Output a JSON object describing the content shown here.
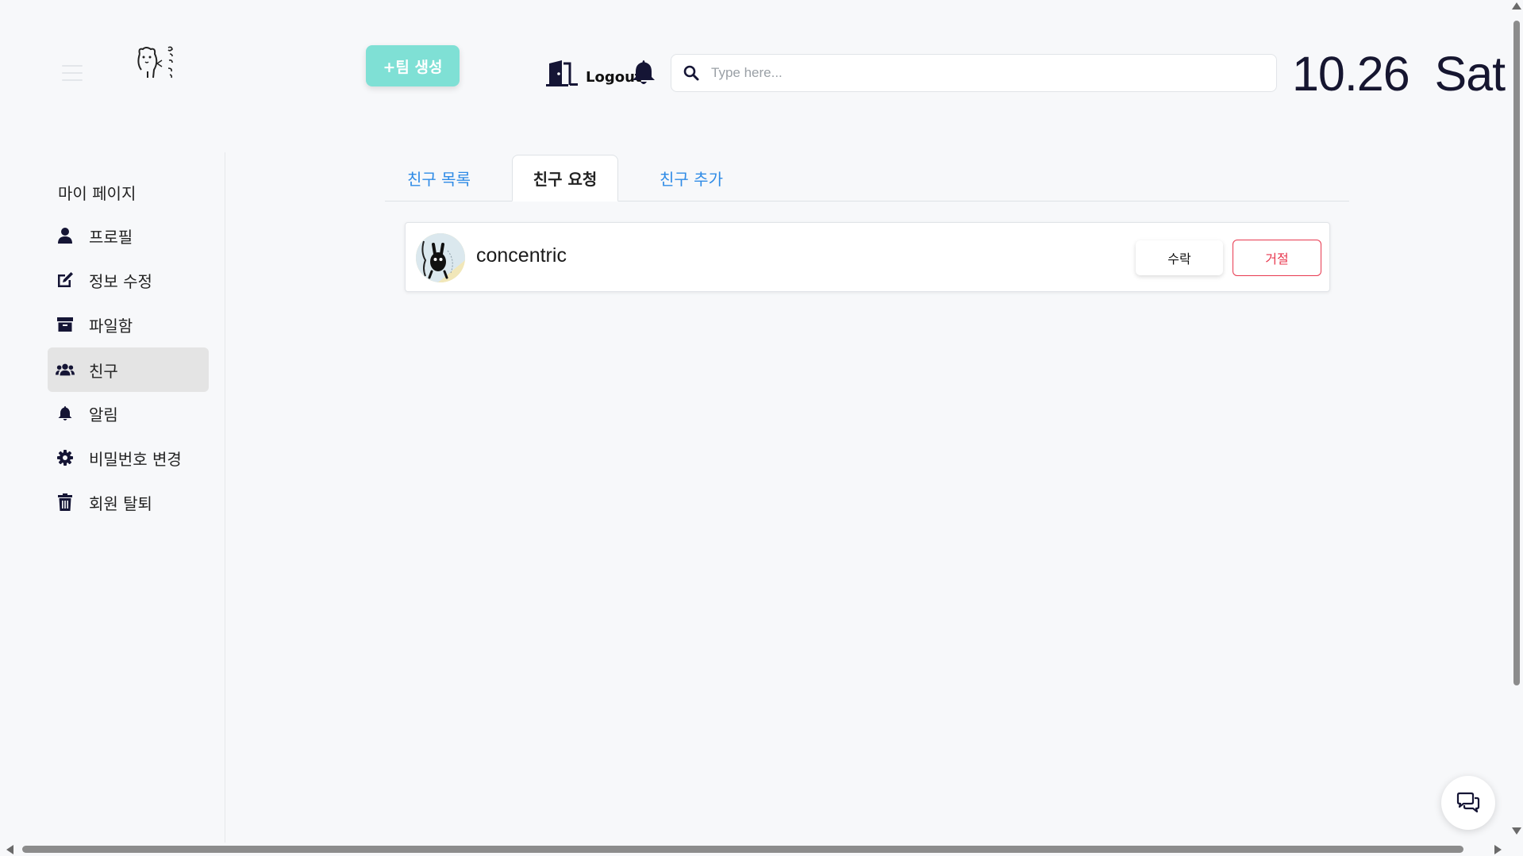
{
  "header": {
    "menu_icon": "hamburger-icon",
    "logo_icon": "bear-logo",
    "team_button_label": "+팀 생성",
    "logout_label": "Logout",
    "logout_icon": "door-exit-icon",
    "notification_icon": "bell-icon",
    "search": {
      "placeholder": "Type here...",
      "value": ""
    },
    "date_label": "10.26  Sat"
  },
  "sidebar": {
    "title": "마이 페이지",
    "items": [
      {
        "label": "프로필",
        "icon": "user-icon",
        "active": false
      },
      {
        "label": "정보 수정",
        "icon": "edit-icon",
        "active": false
      },
      {
        "label": "파일함",
        "icon": "archive-icon",
        "active": false
      },
      {
        "label": "친구",
        "icon": "users-icon",
        "active": true
      },
      {
        "label": "알림",
        "icon": "bell-icon",
        "active": false
      },
      {
        "label": "비밀번호 변경",
        "icon": "gear-icon",
        "active": false
      },
      {
        "label": "회원 탈퇴",
        "icon": "trash-icon",
        "active": false
      }
    ]
  },
  "tabs": [
    {
      "label": "친구 목록",
      "active": false
    },
    {
      "label": "친구 요청",
      "active": true
    },
    {
      "label": "친구 추가",
      "active": false
    }
  ],
  "requests": [
    {
      "username": "concentric",
      "accept_label": "수락",
      "reject_label": "거절"
    }
  ],
  "chat_icon": "chat-bubbles-icon",
  "colors": {
    "accent_teal": "#7fe0d5",
    "tab_link_blue": "#2f8be6",
    "reject_red": "#e8384f",
    "active_item_bg": "#e4e4e4",
    "background": "#f7f8fa"
  }
}
